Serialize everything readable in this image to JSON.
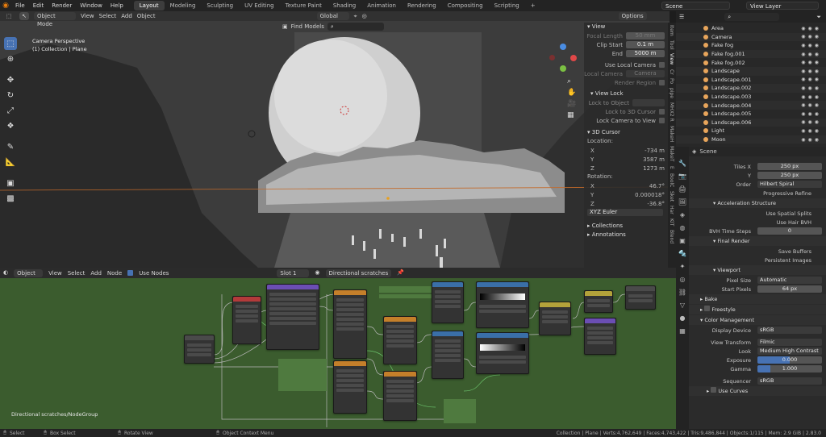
{
  "topbar": {
    "menus": [
      "File",
      "Edit",
      "Render",
      "Window",
      "Help"
    ],
    "workspaces": [
      "Layout",
      "Modeling",
      "Sculpting",
      "UV Editing",
      "Texture Paint",
      "Shading",
      "Animation",
      "Rendering",
      "Compositing",
      "Scripting"
    ],
    "active_workspace": "Layout",
    "scene": "Scene",
    "view_layer": "View Layer"
  },
  "viewport": {
    "mode": "Object Mode",
    "menus": [
      "View",
      "Select",
      "Add",
      "Object"
    ],
    "orientation": "Global",
    "find": "Find Models",
    "options": "Options",
    "overlay_title": "Camera Perspective",
    "overlay_sub": "(1) Collection | Plane"
  },
  "npanel": {
    "view_header": "View",
    "focal_length_label": "Focal Length",
    "focal_length": "50 mm",
    "clip_start_label": "Clip Start",
    "clip_start": "0.1 m",
    "end_label": "End",
    "end": "5000 m",
    "use_local_camera": "Use Local Camera",
    "local_camera_label": "Local Camera",
    "local_camera_value": "Camera",
    "render_region": "Render Region",
    "view_lock_header": "View Lock",
    "lock_to_object": "Lock to Object",
    "lock_to_3d_cursor": "Lock to 3D Cursor",
    "lock_camera_to_view": "Lock Camera to View",
    "cursor_header": "3D Cursor",
    "location_label": "Location:",
    "x_label": "X",
    "x": "-734 m",
    "y_label": "Y",
    "y": "3587 m",
    "z_label": "Z",
    "z": "1273 m",
    "rotation_label": "Rotation:",
    "rx": "46.7°",
    "ry": "0.000018°",
    "rz": "-36.8°",
    "rot_mode": "XYZ Euler",
    "collections_header": "Collections",
    "annotations_header": "Annotations",
    "tabs": [
      "Item",
      "Tool",
      "View",
      "Cr",
      "Po",
      "pipe",
      "MHX2 R",
      "MakeH",
      "MakeT",
      "E",
      "BoolC",
      "Sket",
      "Har",
      "KIT",
      "Blend"
    ]
  },
  "node_editor": {
    "type": "Object",
    "menus": [
      "View",
      "Select",
      "Add",
      "Node"
    ],
    "use_nodes": "Use Nodes",
    "slot": "Slot 1",
    "material": "Directional scratches",
    "breadcrumb": "Directional scratches/NodeGroup"
  },
  "status": {
    "select": "Select",
    "box_select": "Box Select",
    "rotate_view": "Rotate View",
    "context_menu": "Object Context Menu",
    "stats": "Collection | Plane | Verts:4,762,649 | Faces:4,743,422 | Tris:9,486,844 | Objects:1/115 | Mem: 2.9 GiB | 2.83.0"
  },
  "outliner": {
    "items": [
      "Area",
      "Camera",
      "Fake fog",
      "Fake fog.001",
      "Fake fog.002",
      "Landscape",
      "Landscape.001",
      "Landscape.002",
      "Landscape.003",
      "Landscape.004",
      "Landscape.005",
      "Landscape.006",
      "Light",
      "Moon"
    ]
  },
  "properties": {
    "scene_label": "Scene",
    "tiles_x_label": "Tiles X",
    "tiles_x": "250 px",
    "y_label": "Y",
    "tiles_y": "250 px",
    "order_label": "Order",
    "order": "Hilbert Spiral",
    "progressive_refine": "Progressive Refine",
    "accel_header": "Acceleration Structure",
    "use_spatial_splits": "Use Spatial Splits",
    "use_hair_bvh": "Use Hair BVH",
    "bvh_time_steps_label": "BVH Time Steps",
    "bvh_time_steps": "0",
    "final_render_header": "Final Render",
    "save_buffers": "Save Buffers",
    "persistent_images": "Persistent Images",
    "viewport_header": "Viewport",
    "pixel_size_label": "Pixel Size",
    "pixel_size": "Automatic",
    "start_pixels_label": "Start Pixels",
    "start_pixels": "64 px",
    "bake_header": "Bake",
    "freestyle_header": "Freestyle",
    "color_mgmt_header": "Color Management",
    "display_device_label": "Display Device",
    "display_device": "sRGB",
    "view_transform_label": "View Transform",
    "view_transform": "Filmic",
    "look_label": "Look",
    "look": "Medium High Contrast",
    "exposure_label": "Exposure",
    "exposure": "0.000",
    "gamma_label": "Gamma",
    "gamma": "1.000",
    "sequencer_label": "Sequencer",
    "sequencer": "sRGB",
    "use_curves": "Use Curves"
  }
}
